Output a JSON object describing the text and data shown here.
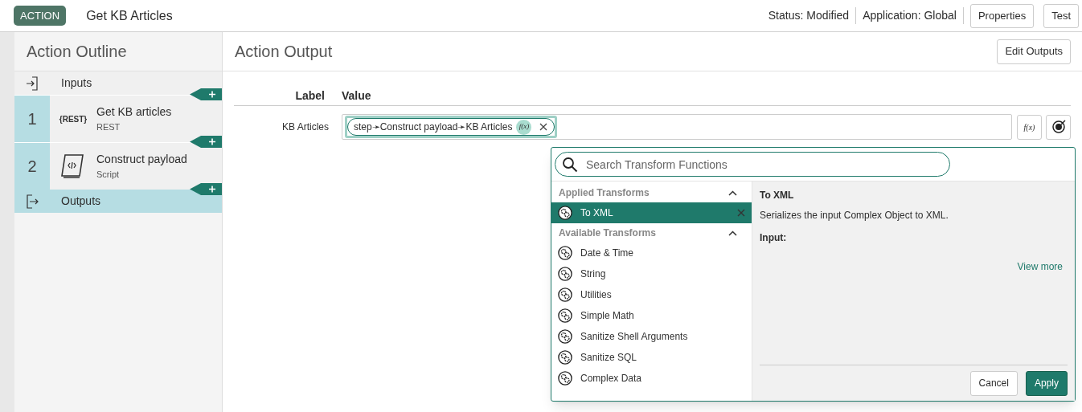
{
  "header": {
    "badge": "ACTION",
    "title": "Get KB Articles",
    "status": "Status: Modified",
    "application": "Application: Global",
    "buttons": [
      "Properties",
      "Test"
    ]
  },
  "outline": {
    "title": "Action Outline",
    "items": [
      {
        "kind": "inputs",
        "label": "Inputs",
        "selected": false
      },
      {
        "kind": "rest_step",
        "number": "1",
        "icon_text": "{REST}",
        "label": "Get KB articles",
        "sub": "REST",
        "selected": false
      },
      {
        "kind": "script_step",
        "number": "2",
        "label": "Construct payload",
        "sub": "Script",
        "selected": false
      },
      {
        "kind": "outputs",
        "label": "Outputs",
        "selected": true
      }
    ]
  },
  "output": {
    "title": "Action Output",
    "edit_button": "Edit Outputs",
    "columns": [
      "Label",
      "Value"
    ],
    "rows": [
      {
        "label": "KB Articles",
        "pill": "step➛Construct payload➛KB Articles",
        "pill_fx": "f(x)",
        "fx_button": "f(x)"
      }
    ]
  },
  "transform": {
    "search_placeholder": "Search Transform Functions",
    "applied_title": "Applied Transforms",
    "applied": [
      {
        "label": "To XML",
        "selected": true
      }
    ],
    "available_title": "Available Transforms",
    "available": [
      {
        "label": "Date & Time",
        "selected": false
      },
      {
        "label": "String",
        "selected": false
      },
      {
        "label": "Utilities",
        "selected": false
      },
      {
        "label": "Simple Math",
        "selected": false
      },
      {
        "label": "Sanitize Shell Arguments",
        "selected": false
      },
      {
        "label": "Sanitize SQL",
        "selected": false
      },
      {
        "label": "Complex Data",
        "selected": false
      }
    ],
    "detail": {
      "title": "To XML",
      "description": "Serializes the input Complex Object to XML.",
      "input_label": "Input:",
      "link": "View more"
    },
    "buttons": [
      "Cancel",
      "Apply"
    ]
  }
}
